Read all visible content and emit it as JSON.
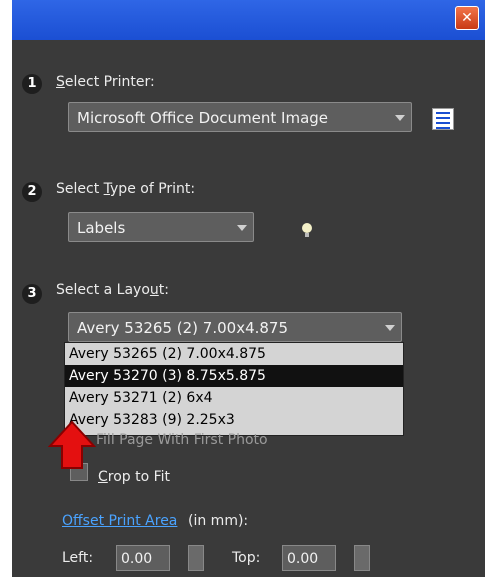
{
  "step1": {
    "number": "1",
    "label_underlined": "S",
    "label_rest": "elect Printer:",
    "printer": "Microsoft Office Document Image"
  },
  "step2": {
    "number": "2",
    "label_pre": "Select ",
    "label_underlined": "T",
    "label_rest": "ype of Print:",
    "type": "Labels"
  },
  "step3": {
    "number": "3",
    "label_pre": "Select a Layo",
    "label_underlined": "u",
    "label_rest": "t:",
    "selected_layout": "Avery 53265 (2) 7.00x4.875",
    "options": [
      "Avery 53265 (2) 7.00x4.875",
      "Avery 53270 (3) 8.75x5.875",
      "Avery 53271 (2) 6x4",
      "Avery 53283 (9) 2.25x3"
    ]
  },
  "fill_page": "Fill Page With First Photo",
  "crop": {
    "underlined": "C",
    "rest": "rop to Fit"
  },
  "offset": {
    "link": "Offset Print Area",
    "units": " (in mm):"
  },
  "left": {
    "label": "Left:",
    "value": "0.00"
  },
  "top": {
    "label": "Top:",
    "value": "0.00"
  },
  "colors": {
    "title_bar": "#1b4fd3",
    "panel": "#3a3a3a",
    "link": "#4aa3ff",
    "selection": "#111111"
  }
}
